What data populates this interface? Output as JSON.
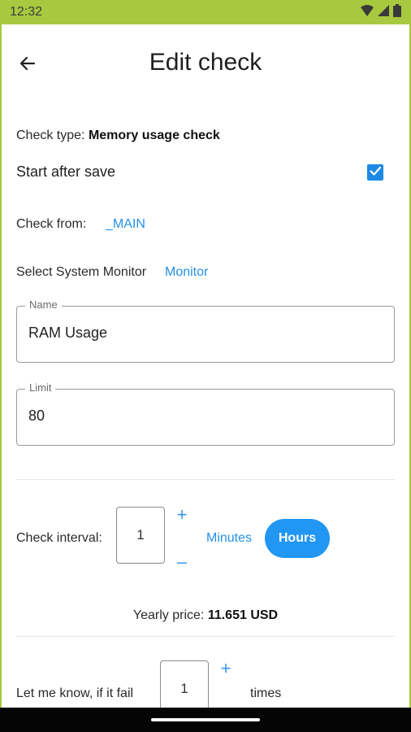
{
  "status": {
    "time": "12:32"
  },
  "header": {
    "title": "Edit check"
  },
  "check_type": {
    "label": "Check type:",
    "value": "Memory usage check"
  },
  "start_after_save": {
    "label": "Start after save",
    "checked": true
  },
  "check_from": {
    "label": "Check from:",
    "value": "_MAIN"
  },
  "system_monitor": {
    "label": "Select System Monitor",
    "value": "Monitor"
  },
  "name_field": {
    "label": "Name",
    "value": "RAM Usage"
  },
  "limit_field": {
    "label": "Limit",
    "value": "80"
  },
  "interval": {
    "label": "Check interval:",
    "value": "1",
    "plus": "+",
    "minus": "–",
    "units": [
      "Minutes",
      "Hours"
    ],
    "selected_unit": "Hours"
  },
  "price": {
    "label": "Yearly price:",
    "value": "11.651 USD"
  },
  "fail": {
    "label": "Let me know, if it fail",
    "value": "1",
    "plus": "+",
    "suffix": "times"
  },
  "colors": {
    "accent": "#2196f3",
    "status_bar": "#a8c93f"
  }
}
